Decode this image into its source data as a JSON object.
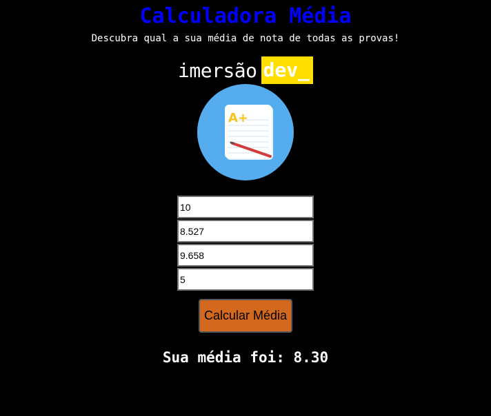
{
  "header": {
    "title": "Calculadora Média",
    "subtitle": "Descubra qual a sua média de nota de todas as provas!"
  },
  "logo": {
    "word": "imersão",
    "highlight": "dev_"
  },
  "illustration": {
    "icon": "notepad-grade-icon",
    "grade_text": "A+"
  },
  "form": {
    "inputs": [
      {
        "value": "10"
      },
      {
        "value": "8.527"
      },
      {
        "value": "9.658"
      },
      {
        "value": "5"
      }
    ],
    "button_label": "Calcular Média"
  },
  "result": {
    "text": "Sua média foi: 8.30"
  },
  "colors": {
    "background": "#000000",
    "title": "#0000ff",
    "logo_highlight": "#ffde00",
    "button": "#d2691e",
    "circle": "#55acee"
  }
}
